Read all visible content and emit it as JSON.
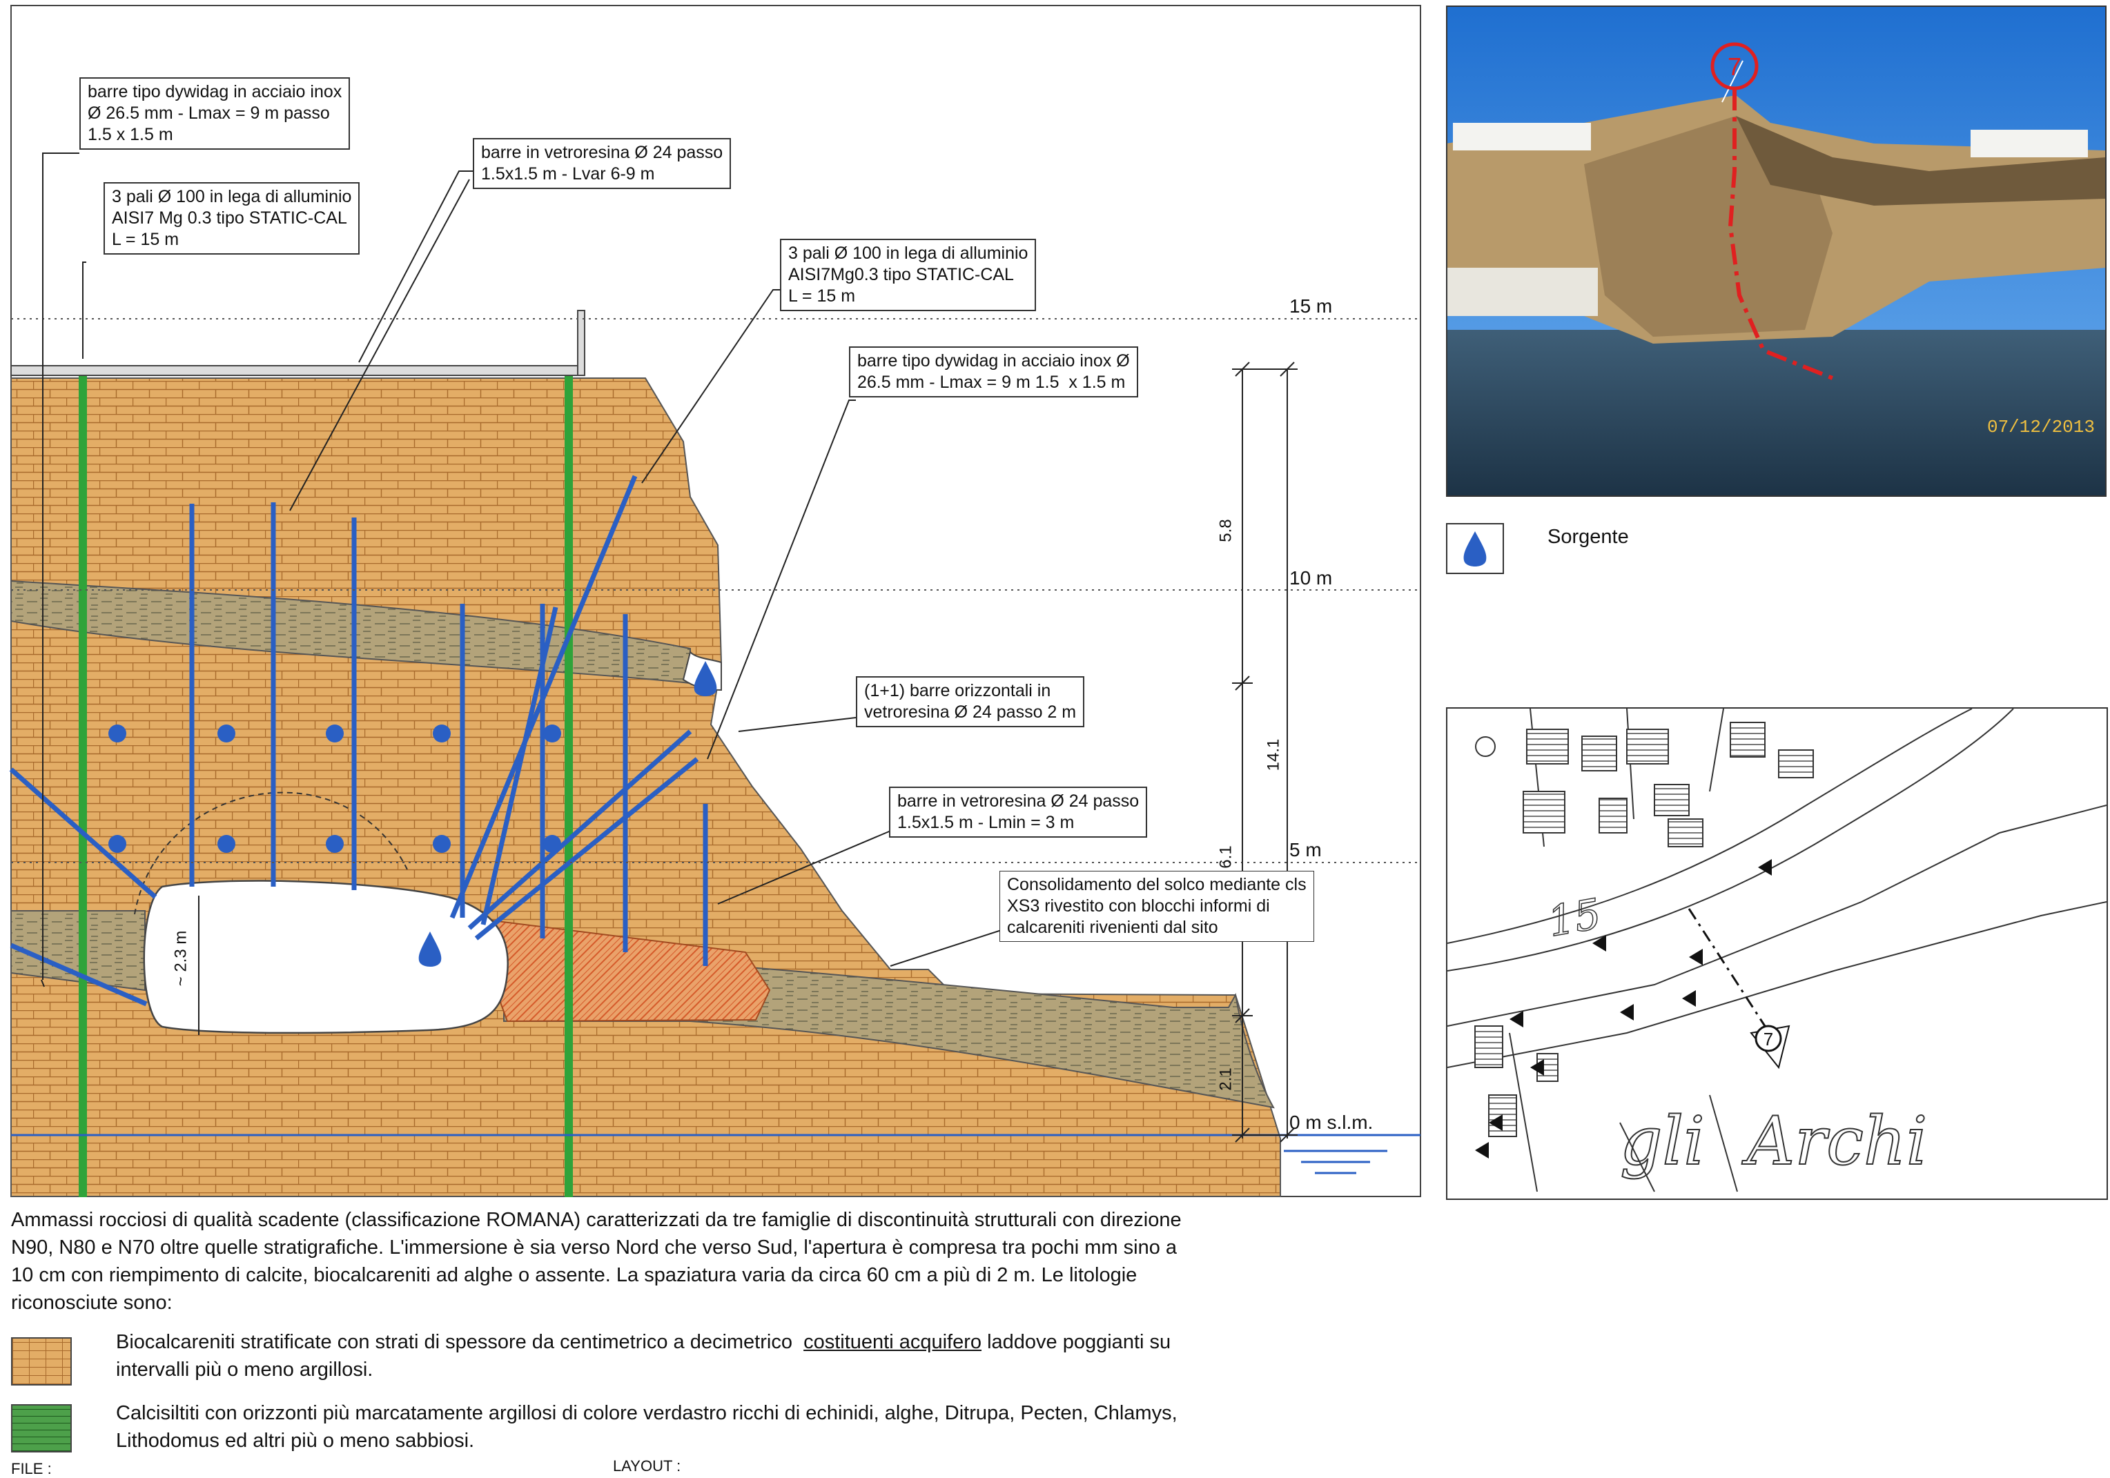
{
  "elevations": {
    "e15": "15 m",
    "e10": "10 m",
    "e5": "5 m",
    "e0": "0 m s.l.m."
  },
  "dimensions": {
    "d58": "5.8",
    "d61": "6.1",
    "d21": "2.1",
    "d141": "14.1",
    "cavity": "~ 2.3 m"
  },
  "callouts": {
    "c1": "barre tipo dywidag in acciaio inox\nØ 26.5 mm - Lmax = 9 m passo\n1.5 x 1.5 m",
    "c2": "barre in vetroresina Ø 24 passo\n1.5x1.5 m - Lvar 6-9 m",
    "c3": "3 pali Ø 100 in lega di alluminio\nAISI7 Mg 0.3 tipo STATIC-CAL\nL = 15 m",
    "c4": "3 pali Ø 100 in lega di alluminio\nAISI7Mg0.3 tipo STATIC-CAL\nL = 15 m",
    "c5": "barre tipo dywidag in acciaio inox Ø\n26.5 mm - Lmax = 9 m 1.5  x 1.5 m",
    "c6": "(1+1) barre orizzontali in\nvetroresina Ø 24 passo 2 m",
    "c7": "barre in vetroresina Ø 24 passo\n1.5x1.5 m - Lmin = 3 m",
    "c8": "Consolidamento del solco mediante cls\nXS3 rivestito con blocchi informi di\ncalcareniti rivenienti dal sito"
  },
  "photo": {
    "date": "07/12/2013",
    "marker": "7"
  },
  "legend_icon": {
    "label": "Sorgente",
    "icon": "water-drop-icon"
  },
  "map": {
    "label": "gli  Archi",
    "contour": "15",
    "marker": "7"
  },
  "description": "Ammassi rocciosi di qualità scadente (classificazione ROMANA) caratterizzati da tre famiglie di discontinuità strutturali con direzione\nN90, N80 e N70 oltre quelle stratigrafiche. L'immersione è sia verso Nord che verso Sud, l'apertura è compresa tra pochi mm sino a\n10 cm con riempimento di calcite, biocalcareniti ad alghe o assente. La spaziatura varia da circa 60 cm a più di 2 m. Le litologie\nriconosciute sono:",
  "legend": {
    "bio_1": "Biocalcareniti stratificate con strati di spessore da centimetrico a decimetrico  ",
    "bio_u": "costituenti acquifero",
    "bio_2": " laddove poggianti su\nintervalli più o meno argillosi.",
    "calc": "Calcisiltiti con orizzonti più marcatamente argillosi di colore verdastro ricchi di echinidi, alghe, Ditrupa, Pecten, Chlamys,\nLithodomus ed altri più o meno sabbiosi."
  },
  "footer": {
    "file": "FILE  :",
    "layout": "LAYOUT  :"
  },
  "colors": {
    "rock": "#e3ad66",
    "clay": "#b3a37a",
    "bar_blue": "#2a5fc4",
    "pile_green": "#2fa33a",
    "hatch": "#e07a3a"
  }
}
